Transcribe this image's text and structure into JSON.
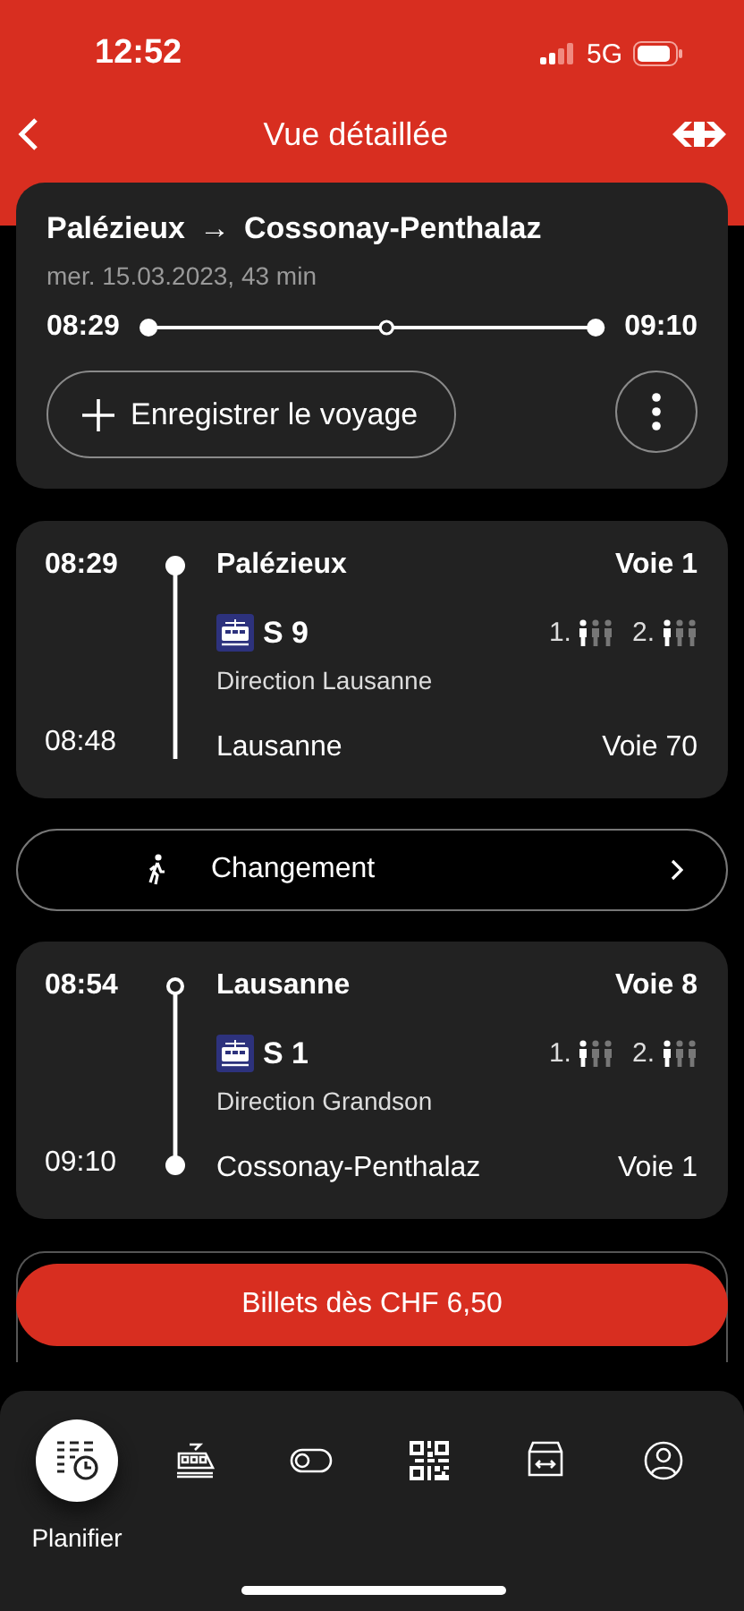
{
  "status_bar": {
    "time": "12:52",
    "network": "5G"
  },
  "header": {
    "title": "Vue détaillée"
  },
  "summary": {
    "from": "Palézieux",
    "arrow": "→",
    "to": "Cossonay-Penthalaz",
    "date": "mer. 15.03.2023, 43 min",
    "departure": "08:29",
    "arrival": "09:10",
    "save_label": "Enregistrer le voyage"
  },
  "legs": [
    {
      "dep_time": "08:29",
      "dep_station": "Palézieux",
      "dep_platform": "Voie 1",
      "start_dot": true,
      "start_hollow": false,
      "line": "S 9",
      "direction": "Direction Lausanne",
      "occupancy": [
        {
          "class": "1."
        },
        {
          "class": "2."
        }
      ],
      "arr_time": "08:48",
      "arr_station": "Lausanne",
      "arr_platform": "Voie 70",
      "end_dot": false
    },
    {
      "dep_time": "08:54",
      "dep_station": "Lausanne",
      "dep_platform": "Voie 8",
      "start_dot": true,
      "start_hollow": true,
      "line": "S 1",
      "direction": "Direction Grandson",
      "occupancy": [
        {
          "class": "1."
        },
        {
          "class": "2."
        }
      ],
      "arr_time": "09:10",
      "arr_station": "Cossonay-Penthalaz",
      "arr_platform": "Voie 1",
      "end_dot": true
    }
  ],
  "change": {
    "label": "Changement"
  },
  "ticket_button": "Billets dès CHF 6,50",
  "tabs": [
    {
      "kind": "planner",
      "label": "Planifier",
      "selected": true
    },
    {
      "kind": "train",
      "selected": false
    },
    {
      "kind": "toggle",
      "selected": false
    },
    {
      "kind": "qr",
      "selected": false
    },
    {
      "kind": "shop",
      "selected": false
    },
    {
      "kind": "profile",
      "selected": false
    }
  ]
}
